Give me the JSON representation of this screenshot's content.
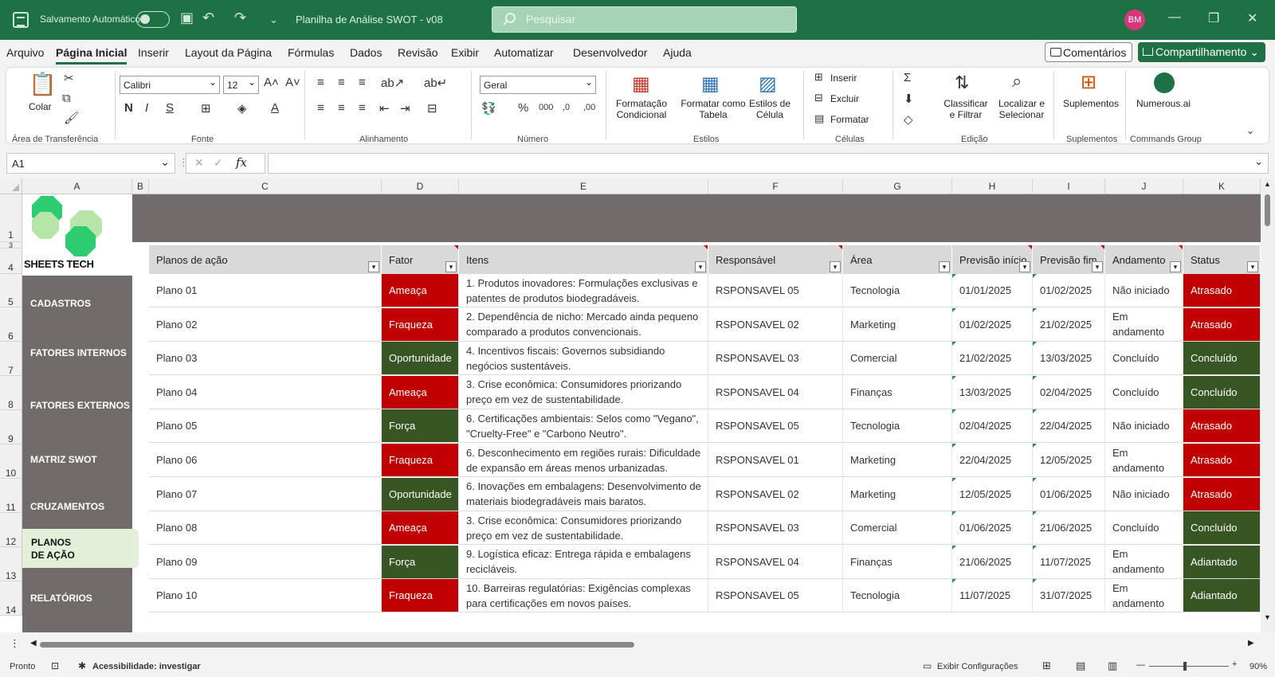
{
  "titlebar": {
    "autosave_label": "Salvamento Automático",
    "file_title": "Planilha de Análise SWOT - v08",
    "search_placeholder": "Pesquisar",
    "user_initials": "BM"
  },
  "menu": {
    "items": [
      "Arquivo",
      "Página Inicial",
      "Inserir",
      "Layout da Página",
      "Fórmulas",
      "Dados",
      "Revisão",
      "Exibir",
      "Automatizar",
      "Desenvolvedor",
      "Ajuda"
    ],
    "active": "Página Inicial",
    "comments_label": "Comentários",
    "share_label": "Compartilhamento"
  },
  "ribbon": {
    "clipboard": {
      "paste": "Colar",
      "label": "Área de Transferência"
    },
    "font": {
      "name": "Calibri",
      "size": "12",
      "label": "Fonte"
    },
    "alignment": {
      "label": "Alinhamento"
    },
    "number": {
      "format": "Geral",
      "label": "Número"
    },
    "styles": {
      "conditional": "Formatação Condicional",
      "table": "Formatar como Tabela",
      "cell": "Estilos de Célula",
      "label": "Estilos"
    },
    "cells": {
      "insert": "Inserir",
      "delete": "Excluir",
      "format": "Formatar",
      "label": "Células"
    },
    "editing": {
      "sort": "Classificar e Filtrar",
      "find": "Localizar e Selecionar",
      "label": "Edição"
    },
    "addins": {
      "button": "Suplementos",
      "label": "Suplementos"
    },
    "commands": {
      "button": "Numerous.ai",
      "label": "Commands Group"
    }
  },
  "formula_bar": {
    "name_box": "A1",
    "fx": "fx",
    "content": ""
  },
  "columns": [
    "A",
    "B",
    "C",
    "D",
    "E",
    "F",
    "G",
    "H",
    "I",
    "J",
    "K"
  ],
  "rows": [
    "1",
    "3",
    "4",
    "5",
    "6",
    "7",
    "8",
    "9",
    "10",
    "11",
    "12",
    "13",
    "14"
  ],
  "logo": {
    "text": "SHEETS TECH"
  },
  "nav": {
    "items": [
      "CADASTROS",
      "FATORES INTERNOS",
      "FATORES EXTERNOS",
      "MATRIZ SWOT",
      "CRUZAMENTOS",
      "RELATÓRIOS"
    ],
    "active_line1": "PLANOS",
    "active_line2": "DE AÇÃO"
  },
  "table": {
    "headers": [
      "Planos de ação",
      "Fator",
      "Itens",
      "Responsável",
      "Área",
      "Previsão início",
      "Previsão fim",
      "Andamento",
      "Status"
    ],
    "rows": [
      [
        "Plano 01",
        "Ameaça",
        "1. Produtos inovadores: Formulações exclusivas e patentes de produtos biodegradáveis.",
        "RSPONSAVEL 05",
        "Tecnologia",
        "01/01/2025",
        "01/02/2025",
        "Não iniciado",
        "Atrasado"
      ],
      [
        "Plano 02",
        "Fraqueza",
        "2. Dependência de nicho: Mercado ainda pequeno comparado a produtos convencionais.",
        "RSPONSAVEL 02",
        "Marketing",
        "01/02/2025",
        "21/02/2025",
        "Em andamento",
        "Atrasado"
      ],
      [
        "Plano 03",
        "Oportunidade",
        "4. Incentivos fiscais: Governos subsidiando negócios sustentáveis.",
        "RSPONSAVEL 03",
        "Comercial",
        "21/02/2025",
        "13/03/2025",
        "Concluído",
        "Concluído"
      ],
      [
        "Plano 04",
        "Ameaça",
        "3. Crise econômica: Consumidores priorizando preço em vez de sustentabilidade.",
        "RSPONSAVEL 04",
        "Finanças",
        "13/03/2025",
        "02/04/2025",
        "Concluído",
        "Concluído"
      ],
      [
        "Plano 05",
        "Força",
        "6. Certificações ambientais: Selos como \"Vegano\", \"Cruelty-Free\" e \"Carbono Neutro\".",
        "RSPONSAVEL 05",
        "Tecnologia",
        "02/04/2025",
        "22/04/2025",
        "Não iniciado",
        "Atrasado"
      ],
      [
        "Plano 06",
        "Fraqueza",
        "6. Desconhecimento em regiões rurais: Dificuldade de expansão em áreas menos urbanizadas.",
        "RSPONSAVEL 01",
        "Marketing",
        "22/04/2025",
        "12/05/2025",
        "Em andamento",
        "Atrasado"
      ],
      [
        "Plano 07",
        "Oportunidade",
        "6. Inovações em embalagens: Desenvolvimento de materiais biodegradáveis mais baratos.",
        "RSPONSAVEL 02",
        "Marketing",
        "12/05/2025",
        "01/06/2025",
        "Não iniciado",
        "Atrasado"
      ],
      [
        "Plano 08",
        "Ameaça",
        "3. Crise econômica: Consumidores priorizando preço em vez de sustentabilidade.",
        "RSPONSAVEL 03",
        "Comercial",
        "01/06/2025",
        "21/06/2025",
        "Concluído",
        "Concluído"
      ],
      [
        "Plano 09",
        "Força",
        "9. Logística eficaz: Entrega rápida e embalagens recicláveis.",
        "RSPONSAVEL 04",
        "Finanças",
        "21/06/2025",
        "11/07/2025",
        "Em andamento",
        "Adiantado"
      ],
      [
        "Plano 10",
        "Fraqueza",
        "10. Barreiras regulatórias: Exigências complexas para certificações em novos países.",
        "RSPONSAVEL 05",
        "Tecnologia",
        "11/07/2025",
        "31/07/2025",
        "Em andamento",
        "Adiantado"
      ]
    ]
  },
  "statusbar": {
    "ready": "Pronto",
    "accessibility": "Acessibilidade: investigar",
    "display_settings": "Exibir Configurações",
    "zoom": "90%"
  },
  "colors": {
    "excel_green": "#1e7145",
    "red": "#c00000",
    "dark_green": "#375623",
    "sidebar_gray": "#726b6b",
    "active_nav": "#e2f0d9"
  }
}
